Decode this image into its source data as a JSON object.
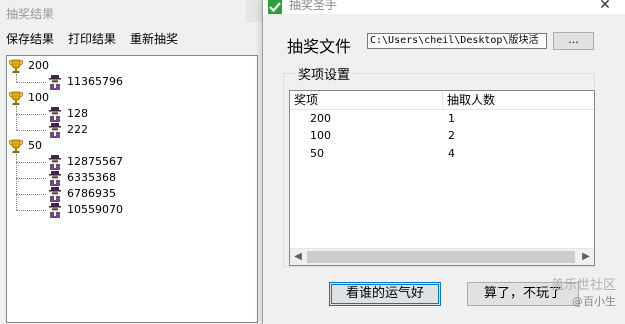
{
  "results_window": {
    "title": "抽奖结果",
    "menu": [
      "保存结果",
      "打印结果",
      "重新抽奖"
    ],
    "tree": [
      {
        "label": "200",
        "children": [
          "11365796"
        ]
      },
      {
        "label": "100",
        "children": [
          "128",
          "222"
        ]
      },
      {
        "label": "50",
        "children": [
          "12875567",
          "6335368",
          "6786935",
          "10559070"
        ]
      }
    ]
  },
  "dialog": {
    "title": "抽奖圣手",
    "file_label": "抽奖文件",
    "file_path": "C:\\Users\\cheil\\Desktop\\版块活",
    "browse_label": "...",
    "groupbox_title": "奖项设置",
    "columns": [
      "奖项",
      "抽取人数"
    ],
    "rows": [
      {
        "prize": "200",
        "count": "1"
      },
      {
        "prize": "100",
        "count": "2"
      },
      {
        "prize": "50",
        "count": "4"
      }
    ],
    "draw_button": "看谁的运气好",
    "quit_button": "算了，不玩了"
  },
  "watermark": {
    "line1": "盖乐世社区",
    "line2": "@百小生"
  },
  "icons": {
    "app_icon": "green-check-icon",
    "prize_icon": "trophy-icon",
    "entry_icon": "person-icon"
  }
}
